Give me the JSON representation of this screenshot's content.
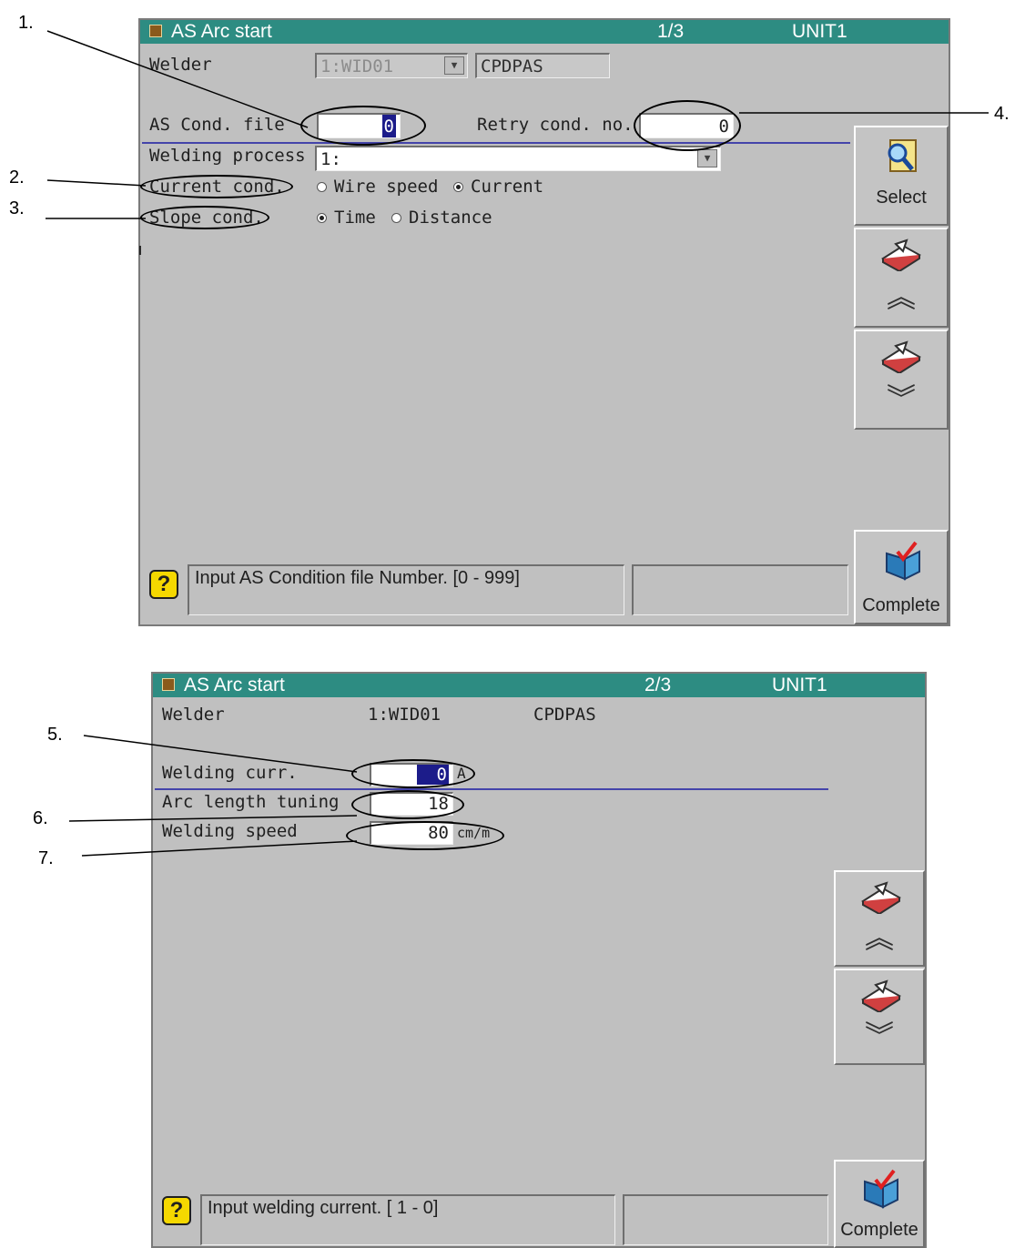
{
  "screen1": {
    "title": "AS Arc start",
    "page": "1/3",
    "unit": "UNIT1",
    "welder_label": "Welder",
    "welder_value": "1:WID01",
    "welder_name": "CPDPAS",
    "as_cond_label": "AS Cond. file",
    "as_cond_value": "0",
    "retry_label": "Retry cond. no.",
    "retry_value": "0",
    "process_label": "Welding process",
    "process_value": "1:",
    "current_label": "Current cond.",
    "current_options": [
      "Wire speed",
      "Current"
    ],
    "current_selected": "Current",
    "slope_label": "Slope cond.",
    "slope_options": [
      "Time",
      "Distance"
    ],
    "slope_selected": "Time",
    "select_label": "Select",
    "complete_label": "Complete",
    "message": "Input AS Condition file Number.  [0 - 999]"
  },
  "screen2": {
    "title": "AS Arc start",
    "page": "2/3",
    "unit": "UNIT1",
    "welder_label": "Welder",
    "welder_value": "1:WID01",
    "welder_name": "CPDPAS",
    "curr_label": "Welding curr.",
    "curr_value": "0",
    "curr_unit": "A",
    "arc_label": "Arc length tuning",
    "arc_value": "18",
    "speed_label": "Welding speed",
    "speed_value": "80",
    "speed_unit": "cm/m",
    "complete_label": "Complete",
    "message": "Input welding current.  [  1 -   0]"
  },
  "callouts": [
    "1.",
    "2.",
    "3.",
    "4.",
    "5.",
    "6.",
    "7."
  ],
  "icons": {
    "window": "window-icon",
    "select": "magnifier-icon",
    "page_up": "book-up-icon",
    "page_down": "book-down-icon",
    "complete": "folder-check-icon",
    "help": "help-icon"
  },
  "colors": {
    "titlebar": "#2d8c82",
    "panel": "#c0c0c0",
    "cursor": "#1c1c8a",
    "divider": "#4444aa",
    "help": "#f5d800"
  }
}
